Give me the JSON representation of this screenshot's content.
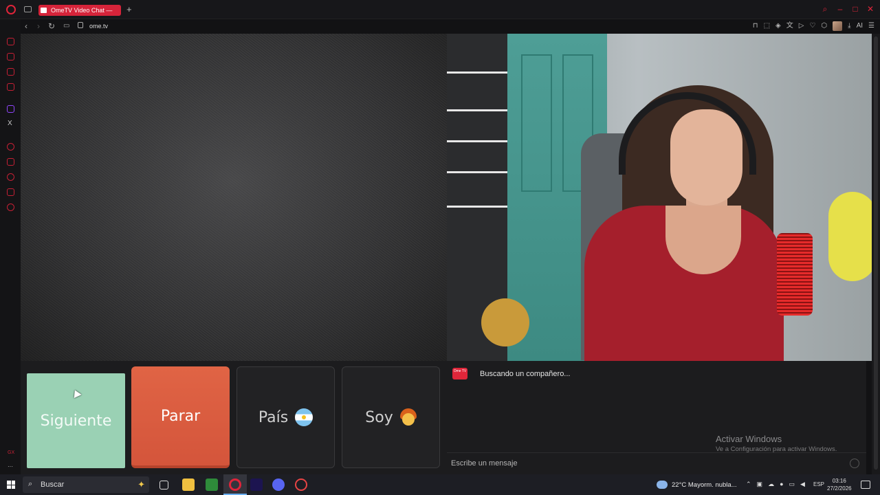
{
  "browser": {
    "tab_title": "OmeTV Video Chat — ",
    "new_tab": "+",
    "url": "ome.tv",
    "toolbar_ai": "AI"
  },
  "sidebar": {
    "gx_label": "GX",
    "more_label": "···",
    "x_label": "X"
  },
  "controls": {
    "next_label": "Siguiente",
    "stop_label": "Parar",
    "country_label": "País",
    "country_flag": "argentina-flag-icon",
    "gender_label": "Soy",
    "gender_icon": "boy-emoji-icon"
  },
  "chat": {
    "logo_text": "Ome TV",
    "status": "Buscando un compañero...",
    "message_placeholder": "Escribe un mensaje",
    "activate_title": "Activar Windows",
    "activate_sub": "Ve a Configuración para activar Windows."
  },
  "taskbar": {
    "search_label": "Buscar",
    "weather": "22°C  Mayorm. nubla...",
    "language": "ESP",
    "time": "03:16",
    "date": "27/2/2026"
  },
  "colors": {
    "brand_red": "#e0243a",
    "next_green": "#9ad1b4",
    "stop_orange": "#e06445"
  }
}
